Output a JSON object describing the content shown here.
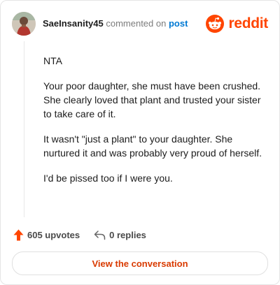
{
  "header": {
    "username": "SaeInsanity45",
    "commented_on": "commented on",
    "post_link": "post",
    "logo_text": "reddit"
  },
  "comment": {
    "paragraphs": [
      "NTA",
      "Your poor daughter, she must have been crushed. She clearly loved that plant and trusted your sister to take care of it.",
      "It wasn't \"just a plant\" to your daughter. She nurtured it and was probably very proud of herself.",
      "I'd be pissed too if I were you."
    ]
  },
  "stats": {
    "upvotes": "605 upvotes",
    "replies": "0 replies"
  },
  "cta": {
    "label": "View the conversation"
  },
  "colors": {
    "accent": "#ff4500",
    "link": "#0079d3",
    "cta_text": "#d93a00"
  },
  "icons": {
    "avatar": "avatar-photo",
    "logo": "reddit-snoo-icon",
    "upvote": "upvote-arrow-icon",
    "reply": "reply-arrow-icon"
  }
}
